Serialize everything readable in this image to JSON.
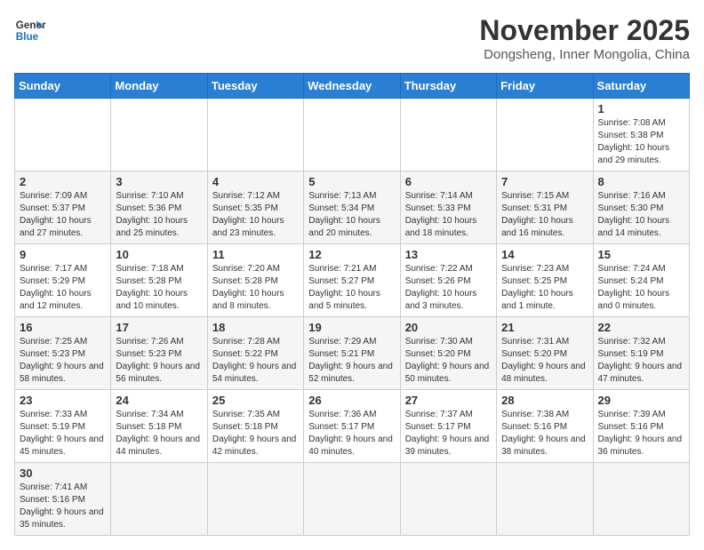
{
  "logo": {
    "text_general": "General",
    "text_blue": "Blue"
  },
  "header": {
    "month": "November 2025",
    "location": "Dongsheng, Inner Mongolia, China"
  },
  "weekdays": [
    "Sunday",
    "Monday",
    "Tuesday",
    "Wednesday",
    "Thursday",
    "Friday",
    "Saturday"
  ],
  "days": [
    {
      "num": "",
      "info": ""
    },
    {
      "num": "",
      "info": ""
    },
    {
      "num": "",
      "info": ""
    },
    {
      "num": "",
      "info": ""
    },
    {
      "num": "",
      "info": ""
    },
    {
      "num": "",
      "info": ""
    },
    {
      "num": "1",
      "info": "Sunrise: 7:08 AM\nSunset: 5:38 PM\nDaylight: 10 hours and 29 minutes."
    },
    {
      "num": "2",
      "info": "Sunrise: 7:09 AM\nSunset: 5:37 PM\nDaylight: 10 hours and 27 minutes."
    },
    {
      "num": "3",
      "info": "Sunrise: 7:10 AM\nSunset: 5:36 PM\nDaylight: 10 hours and 25 minutes."
    },
    {
      "num": "4",
      "info": "Sunrise: 7:12 AM\nSunset: 5:35 PM\nDaylight: 10 hours and 23 minutes."
    },
    {
      "num": "5",
      "info": "Sunrise: 7:13 AM\nSunset: 5:34 PM\nDaylight: 10 hours and 20 minutes."
    },
    {
      "num": "6",
      "info": "Sunrise: 7:14 AM\nSunset: 5:33 PM\nDaylight: 10 hours and 18 minutes."
    },
    {
      "num": "7",
      "info": "Sunrise: 7:15 AM\nSunset: 5:31 PM\nDaylight: 10 hours and 16 minutes."
    },
    {
      "num": "8",
      "info": "Sunrise: 7:16 AM\nSunset: 5:30 PM\nDaylight: 10 hours and 14 minutes."
    },
    {
      "num": "9",
      "info": "Sunrise: 7:17 AM\nSunset: 5:29 PM\nDaylight: 10 hours and 12 minutes."
    },
    {
      "num": "10",
      "info": "Sunrise: 7:18 AM\nSunset: 5:28 PM\nDaylight: 10 hours and 10 minutes."
    },
    {
      "num": "11",
      "info": "Sunrise: 7:20 AM\nSunset: 5:28 PM\nDaylight: 10 hours and 8 minutes."
    },
    {
      "num": "12",
      "info": "Sunrise: 7:21 AM\nSunset: 5:27 PM\nDaylight: 10 hours and 5 minutes."
    },
    {
      "num": "13",
      "info": "Sunrise: 7:22 AM\nSunset: 5:26 PM\nDaylight: 10 hours and 3 minutes."
    },
    {
      "num": "14",
      "info": "Sunrise: 7:23 AM\nSunset: 5:25 PM\nDaylight: 10 hours and 1 minute."
    },
    {
      "num": "15",
      "info": "Sunrise: 7:24 AM\nSunset: 5:24 PM\nDaylight: 10 hours and 0 minutes."
    },
    {
      "num": "16",
      "info": "Sunrise: 7:25 AM\nSunset: 5:23 PM\nDaylight: 9 hours and 58 minutes."
    },
    {
      "num": "17",
      "info": "Sunrise: 7:26 AM\nSunset: 5:23 PM\nDaylight: 9 hours and 56 minutes."
    },
    {
      "num": "18",
      "info": "Sunrise: 7:28 AM\nSunset: 5:22 PM\nDaylight: 9 hours and 54 minutes."
    },
    {
      "num": "19",
      "info": "Sunrise: 7:29 AM\nSunset: 5:21 PM\nDaylight: 9 hours and 52 minutes."
    },
    {
      "num": "20",
      "info": "Sunrise: 7:30 AM\nSunset: 5:20 PM\nDaylight: 9 hours and 50 minutes."
    },
    {
      "num": "21",
      "info": "Sunrise: 7:31 AM\nSunset: 5:20 PM\nDaylight: 9 hours and 48 minutes."
    },
    {
      "num": "22",
      "info": "Sunrise: 7:32 AM\nSunset: 5:19 PM\nDaylight: 9 hours and 47 minutes."
    },
    {
      "num": "23",
      "info": "Sunrise: 7:33 AM\nSunset: 5:19 PM\nDaylight: 9 hours and 45 minutes."
    },
    {
      "num": "24",
      "info": "Sunrise: 7:34 AM\nSunset: 5:18 PM\nDaylight: 9 hours and 44 minutes."
    },
    {
      "num": "25",
      "info": "Sunrise: 7:35 AM\nSunset: 5:18 PM\nDaylight: 9 hours and 42 minutes."
    },
    {
      "num": "26",
      "info": "Sunrise: 7:36 AM\nSunset: 5:17 PM\nDaylight: 9 hours and 40 minutes."
    },
    {
      "num": "27",
      "info": "Sunrise: 7:37 AM\nSunset: 5:17 PM\nDaylight: 9 hours and 39 minutes."
    },
    {
      "num": "28",
      "info": "Sunrise: 7:38 AM\nSunset: 5:16 PM\nDaylight: 9 hours and 38 minutes."
    },
    {
      "num": "29",
      "info": "Sunrise: 7:39 AM\nSunset: 5:16 PM\nDaylight: 9 hours and 36 minutes."
    },
    {
      "num": "30",
      "info": "Sunrise: 7:41 AM\nSunset: 5:16 PM\nDaylight: 9 hours and 35 minutes."
    },
    {
      "num": "",
      "info": ""
    },
    {
      "num": "",
      "info": ""
    },
    {
      "num": "",
      "info": ""
    },
    {
      "num": "",
      "info": ""
    },
    {
      "num": "",
      "info": ""
    },
    {
      "num": "",
      "info": ""
    }
  ]
}
